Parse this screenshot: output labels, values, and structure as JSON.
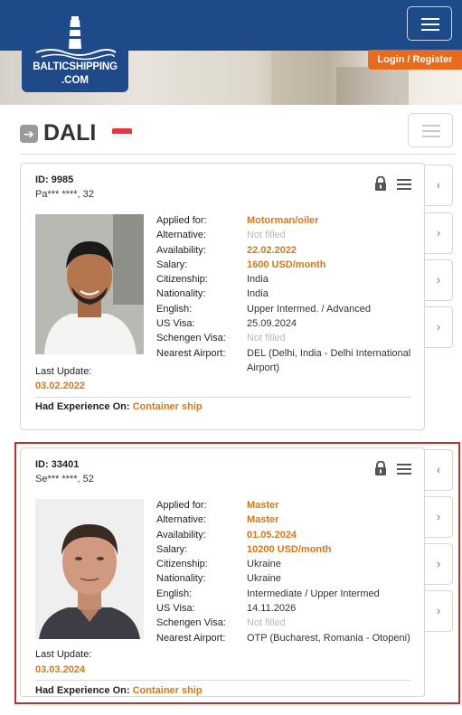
{
  "header": {
    "logo_line1": "BALTICSHIPPING",
    "logo_line2": ".COM",
    "login_label": "Login",
    "separator": "/",
    "register_label": "Register"
  },
  "page": {
    "title": "DALI",
    "flag_icon": "singapore-flag-icon"
  },
  "colors": {
    "brand_blue": "#1f4a8a",
    "accent_orange": "#d4781f",
    "login_orange": "#e86a1c",
    "highlight_red": "#d12a2a"
  },
  "cards": [
    {
      "id": "ID: 9985",
      "name_age": "Pa*** ****, 32",
      "fields": [
        {
          "label": "Applied for:",
          "value": "Motorman/oiler",
          "style": "hl"
        },
        {
          "label": "Alternative:",
          "value": "Not filled",
          "style": "nf"
        },
        {
          "label": "Availability:",
          "value": "22.02.2022",
          "style": "hl"
        },
        {
          "label": "Salary:",
          "value": "1600 USD/month",
          "style": "hl"
        },
        {
          "label": "Citizenship:",
          "value": "India",
          "style": ""
        },
        {
          "label": "Nationality:",
          "value": "India",
          "style": ""
        },
        {
          "label": "English:",
          "value": "Upper Intermed. / Advanced",
          "style": ""
        },
        {
          "label": "US Visa:",
          "value": "25.09.2024",
          "style": ""
        },
        {
          "label": "Schengen Visa:",
          "value": "Not filled",
          "style": "nf"
        },
        {
          "label": "Nearest Airport:",
          "value": "DEL (Delhi, India - Delhi International Airport)",
          "style": "wrap"
        }
      ],
      "last_update_label": "Last Update:",
      "last_update": "03.02.2022",
      "experience_label": "Had Experience On:",
      "experience_value": "Container ship"
    },
    {
      "id": "ID: 33401",
      "name_age": "Se*** ****, 52",
      "fields": [
        {
          "label": "Applied for:",
          "value": "Master",
          "style": "hl"
        },
        {
          "label": "Alternative:",
          "value": "Master",
          "style": "hl"
        },
        {
          "label": "Availability:",
          "value": "01.05.2024",
          "style": "hl"
        },
        {
          "label": "Salary:",
          "value": "10200 USD/month",
          "style": "hl"
        },
        {
          "label": "Citizenship:",
          "value": "Ukraine",
          "style": ""
        },
        {
          "label": "Nationality:",
          "value": "Ukraine",
          "style": ""
        },
        {
          "label": "English:",
          "value": "Intermediate / Upper Intermed",
          "style": ""
        },
        {
          "label": "US Visa:",
          "value": "14.11.2026",
          "style": ""
        },
        {
          "label": "Schengen Visa:",
          "value": "Not filled",
          "style": "nf"
        },
        {
          "label": "Nearest Airport:",
          "value": "OTP (Bucharest, Romania - Otopeni)",
          "style": "wrap"
        }
      ],
      "last_update_label": "Last Update:",
      "last_update": "03.03.2024",
      "experience_label": "Had Experience On:",
      "experience_value": "Container ship"
    }
  ]
}
